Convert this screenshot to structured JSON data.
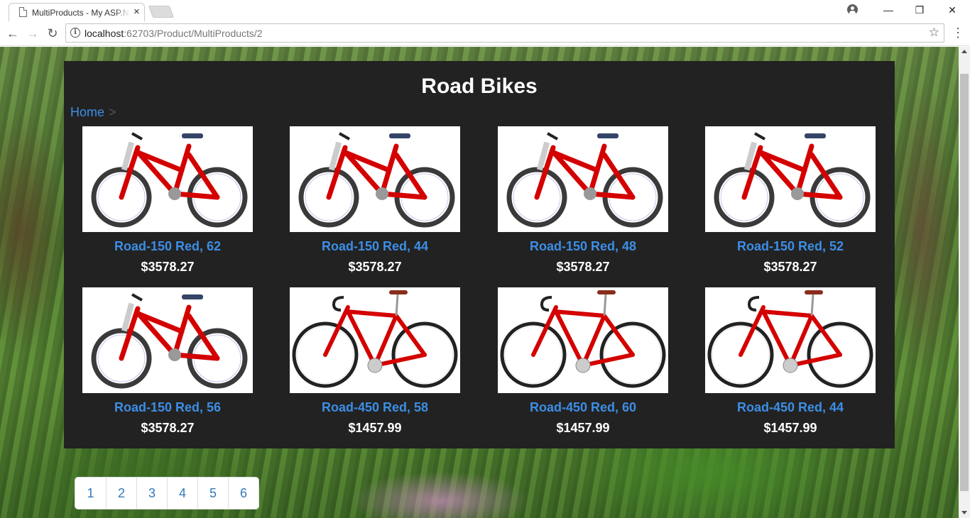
{
  "browser": {
    "tab_title": "MultiProducts - My ASP.NET Application",
    "tab_close": "×",
    "url_host": "localhost",
    "url_path": ":62703/Product/MultiProducts/2",
    "window_minimize": "—",
    "window_maximize": "❐",
    "window_close": "✕",
    "back": "←",
    "forward": "→",
    "reload": "↻",
    "star": "☆",
    "menu": "⋮",
    "info": "i"
  },
  "page": {
    "title": "Road Bikes",
    "breadcrumb_home": "Home",
    "breadcrumb_separator": ">"
  },
  "products": [
    {
      "name": "Road-150 Red, 62",
      "price": "$3578.27",
      "bike": "mountain"
    },
    {
      "name": "Road-150 Red, 44",
      "price": "$3578.27",
      "bike": "mountain"
    },
    {
      "name": "Road-150 Red, 48",
      "price": "$3578.27",
      "bike": "mountain"
    },
    {
      "name": "Road-150 Red, 52",
      "price": "$3578.27",
      "bike": "mountain"
    },
    {
      "name": "Road-150 Red, 56",
      "price": "$3578.27",
      "bike": "mountain"
    },
    {
      "name": "Road-450 Red, 58",
      "price": "$1457.99",
      "bike": "road"
    },
    {
      "name": "Road-450 Red, 60",
      "price": "$1457.99",
      "bike": "road"
    },
    {
      "name": "Road-450 Red, 44",
      "price": "$1457.99",
      "bike": "road"
    }
  ],
  "pagination": [
    "1",
    "2",
    "3",
    "4",
    "5",
    "6"
  ],
  "colors": {
    "panel_bg": "#222222",
    "link_blue": "#3c8ee6",
    "bike_red": "#d40000",
    "tire": "#333333"
  }
}
